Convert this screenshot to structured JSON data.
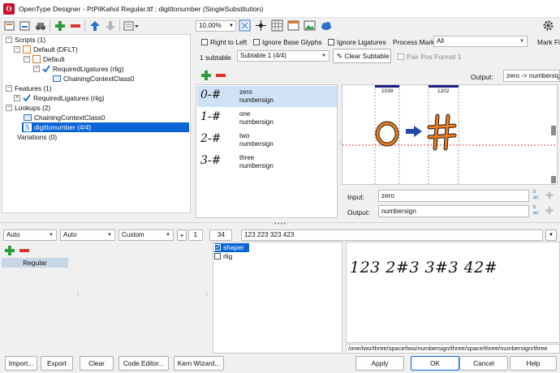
{
  "window": {
    "title": "OpenType Designer - PtPilKahol Regular.ttf : digittonumber (SingleSubstitution)"
  },
  "toolbar": {
    "zoom": "10.00%"
  },
  "tree": {
    "scripts": "Scripts (1)",
    "default_dflt": "Default (DFLT)",
    "default": "Default",
    "required_ligatures_rlig": "RequiredLigatures (rlig)",
    "chaining_context_class0": "ChainingContextClass0",
    "features": "Features (1)",
    "feature_rlig": "RequiredLigatures (rlig)",
    "lookups": "Lookups (2)",
    "lookup_chaining": "ChainingContextClass0",
    "lookup_digittonumber": "digittonumber (4/4)",
    "variations": "Variations (0)"
  },
  "options": {
    "right_to_left": "Right to Left",
    "ignore_base_glyphs": "Ignore Base Glyphs",
    "ignore_ligatures": "Ignore Ligatures",
    "process_marks_label": "Process Marks:",
    "process_marks_value": "All",
    "mark_filter": "Mark Fil",
    "subtable_count": "1 subtable",
    "subtable_select": "Subtable 1 (4/4)",
    "clear_subtable": "Clear Subtable",
    "pair_pos_format": "Pair Pos Format 1",
    "output_label": "Output:",
    "output_value": "zero -> numbersign"
  },
  "glyph_pairs": [
    {
      "preview": "0-#",
      "input": "zero",
      "output": "numbersign"
    },
    {
      "preview": "1-#",
      "input": "one",
      "output": "numbersign"
    },
    {
      "preview": "2-#",
      "input": "two",
      "output": "numbersign"
    },
    {
      "preview": "3-#",
      "input": "three",
      "output": "numbersign"
    }
  ],
  "preview": {
    "left_advance": "1039",
    "right_advance": "1202"
  },
  "io": {
    "input_label": "Input:",
    "input_value": "zero",
    "output_label": "Output:",
    "output_value": "numbersign"
  },
  "bottom": {
    "auto1": "Auto",
    "auto2": "Auto",
    "custom": "Custom",
    "num1": "1",
    "num2": "34",
    "text_input": "123 223 323 423",
    "style_header": "Regular",
    "features": [
      {
        "label": "shaper",
        "checked": true
      },
      {
        "label": "rlig",
        "checked": false
      }
    ],
    "rendered_text": "123 2#3 3#3 42#",
    "glyph_path": "/one/two/three/space/two/numbersign/three/space/three/numbersign/three"
  },
  "footer": {
    "import": "Import...",
    "export": "Export",
    "clear": "Clear",
    "code_editor": "Code Editor...",
    "kern_wizard": "Kern Wizard...",
    "apply": "Apply",
    "ok": "OK",
    "cancel": "Cancel",
    "help": "Help"
  },
  "colors": {
    "selection": "#0a64d6",
    "accent_green": "#2e9b40",
    "accent_red": "#d9342b",
    "arrow_blue": "#1f4aa8",
    "navy": "#1a1a80",
    "glyph_orange": "#ef7d1a"
  }
}
